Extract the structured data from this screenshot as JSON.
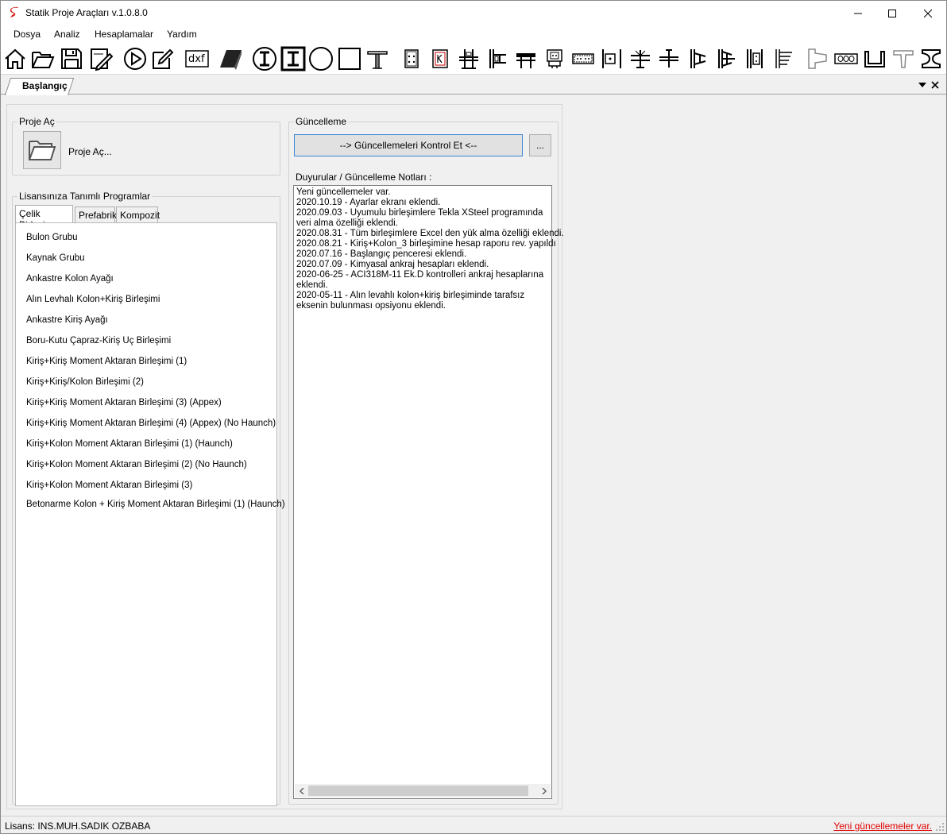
{
  "window": {
    "title": "Statik Proje Araçları v.1.0.8.0"
  },
  "menu": [
    "Dosya",
    "Analiz",
    "Hesaplamalar",
    "Yardım"
  ],
  "toolbar": {
    "icons": [
      "home-icon",
      "open-folder-icon",
      "save-icon",
      "edit-drawing-icon",
      "play-icon",
      "pencil-icon",
      "dxf-icon",
      "3d-plate-icon",
      "i-beam-circle-icon",
      "i-beam-square-icon",
      "circle-section-icon",
      "square-section-icon",
      "t-column-icon",
      "plate-bolts-icon",
      "plate-k-icon",
      "beam-column-icon",
      "column-flange-icon",
      "beam-stiffener-icon",
      "base-plate-icon",
      "beam-splice-icon",
      "column-splice-icon",
      "beam-beam-icon",
      "beam-web-icon",
      "column-cap-icon",
      "column-end-icon",
      "column-side-icon",
      "column-plate-icon",
      "column-haunch-icon",
      "precast-corbel-icon",
      "hollow-core-icon",
      "u-section-icon",
      "t-section-icon",
      "i-section-icon"
    ],
    "dxf_label": "dxf"
  },
  "doc_tab": {
    "label": "Başlangıç"
  },
  "open_project": {
    "group_label": "Proje Aç",
    "button_label": "Proje Aç..."
  },
  "programs": {
    "group_label": "Lisansınıza Tanımlı Programlar",
    "tabs": [
      "Çelik Birleşim",
      "Prefabrik",
      "Kompozit"
    ],
    "items": [
      "Bulon Grubu",
      "Kaynak Grubu",
      "Ankastre Kolon Ayağı",
      "Alın Levhalı Kolon+Kiriş Birleşimi",
      "Ankastre Kiriş Ayağı",
      "Boru-Kutu Çapraz-Kiriş Uç Birleşimi",
      "Kiriş+Kiriş Moment Aktaran Birleşimi (1)",
      "Kiriş+Kiriş/Kolon Birleşimi (2)",
      "Kiriş+Kiriş Moment Aktaran Birleşimi (3) (Appex)",
      "Kiriş+Kiriş Moment Aktaran Birleşimi (4) (Appex) (No Haunch)",
      "Kiriş+Kolon Moment Aktaran Birleşimi (1) (Haunch)",
      "Kiriş+Kolon Moment Aktaran Birleşimi (2) (No Haunch)",
      "Kiriş+Kolon Moment Aktaran Birleşimi (3)",
      "Betonarme Kolon + Kiriş Moment Aktaran Birleşimi (1) (Haunch)"
    ]
  },
  "update": {
    "group_label": "Güncelleme",
    "check_button": "--> Güncellemeleri Kontrol Et <--",
    "dots_button": "...",
    "notes_label": "Duyurular / Güncelleme Notları :",
    "notes": [
      "Yeni güncellemeler var.",
      "2020.10.19 - Ayarlar ekranı eklendi.",
      "2020.09.03 - Uyumulu birleşimlere Tekla XSteel programında",
      "veri alma özelliği eklendi.",
      "2020.08.31 - Tüm birleşimlere Excel den yük alma özelliği eklendi.",
      "2020.08.21 - Kiriş+Kolon_3 birleşimine hesap raporu rev. yapıldı",
      "2020.07.16 - Başlangıç penceresi eklendi.",
      "2020.07.09 - Kimyasal ankraj hesapları eklendi.",
      "2020-06-25 - ACI318M-11 Ek.D kontrolleri ankraj hesaplarına",
      "eklendi.",
      "2020-05-11 - Alın levahlı kolon+kiriş birleşiminde tarafsız",
      "eksenin bulunması opsiyonu eklendi."
    ]
  },
  "status": {
    "license": "Lisans: INS.MUH.SADIK OZBABA",
    "update_link": "Yeni güncellemeler var."
  },
  "colors": {
    "accent_border": "#3a87d6",
    "link_red": "#e00000",
    "app_icon_red": "#d7261e"
  }
}
